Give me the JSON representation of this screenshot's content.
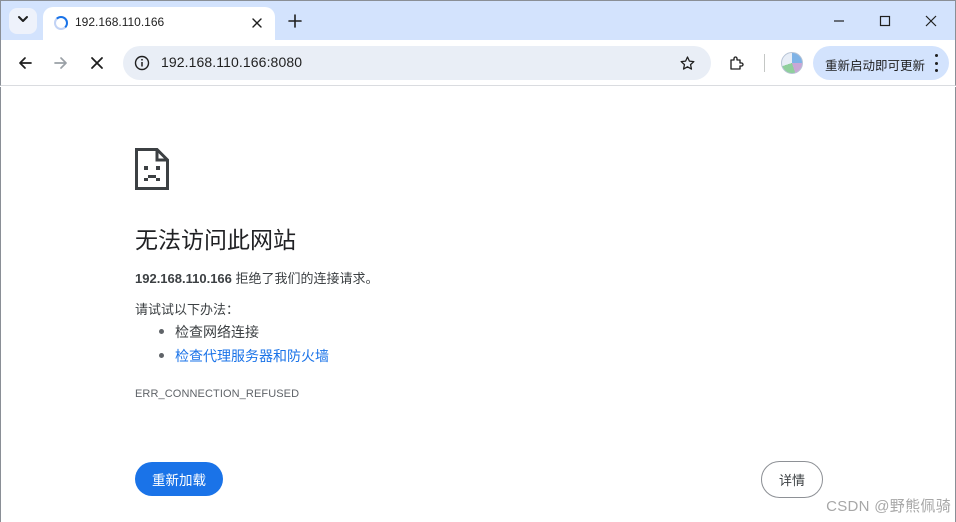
{
  "browser": {
    "tab": {
      "title": "192.168.110.166"
    },
    "omnibox": {
      "url": "192.168.110.166:8080"
    },
    "update_button": {
      "label": "重新启动即可更新"
    }
  },
  "error_page": {
    "title": "无法访问此网站",
    "host": "192.168.110.166",
    "summary_rest": " 拒绝了我们的连接请求。",
    "try_label": "请试试以下办法：",
    "suggestions": [
      {
        "text": "检查网络连接"
      },
      {
        "text": "检查代理服务器和防火墙"
      }
    ],
    "error_code": "ERR_CONNECTION_REFUSED",
    "reload_label": "重新加载",
    "details_label": "详情"
  },
  "watermark": "CSDN @野熊佩骑",
  "colors": {
    "tabstrip_bg": "#d3e3fd",
    "omnibox_bg": "#e9eef6",
    "primary_blue": "#1a73e8",
    "text_dark": "#202124"
  }
}
